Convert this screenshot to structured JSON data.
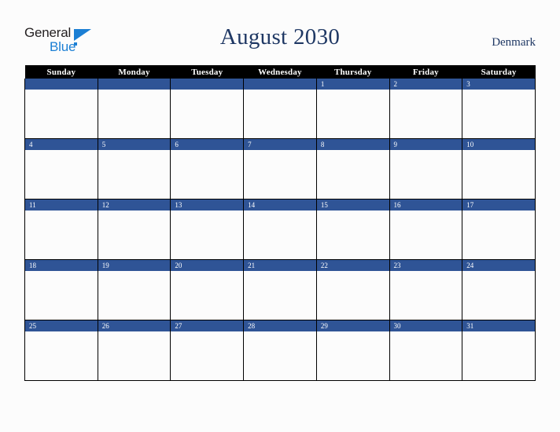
{
  "brand": {
    "name_top": "General",
    "name_bottom": "Blue",
    "triangle_icon": "triangle-icon",
    "color_dark": "#231f20",
    "color_blue": "#1b7fd4"
  },
  "header": {
    "title": "August 2030",
    "locale": "Denmark",
    "title_color": "#1f3864"
  },
  "calendar": {
    "month": "August",
    "year": "2030",
    "country": "Denmark",
    "header_bg": "#000000",
    "header_fg": "#ffffff",
    "date_bar_bg": "#2f5496",
    "date_bar_fg": "#ffffff",
    "cell_bg": "#fcfcfc",
    "border_color": "#000000",
    "weekdays": [
      "Sunday",
      "Monday",
      "Tuesday",
      "Wednesday",
      "Thursday",
      "Friday",
      "Saturday"
    ],
    "weeks": [
      [
        "",
        "",
        "",
        "",
        "1",
        "2",
        "3"
      ],
      [
        "4",
        "5",
        "6",
        "7",
        "8",
        "9",
        "10"
      ],
      [
        "11",
        "12",
        "13",
        "14",
        "15",
        "16",
        "17"
      ],
      [
        "18",
        "19",
        "20",
        "21",
        "22",
        "23",
        "24"
      ],
      [
        "25",
        "26",
        "27",
        "28",
        "29",
        "30",
        "31"
      ]
    ]
  }
}
